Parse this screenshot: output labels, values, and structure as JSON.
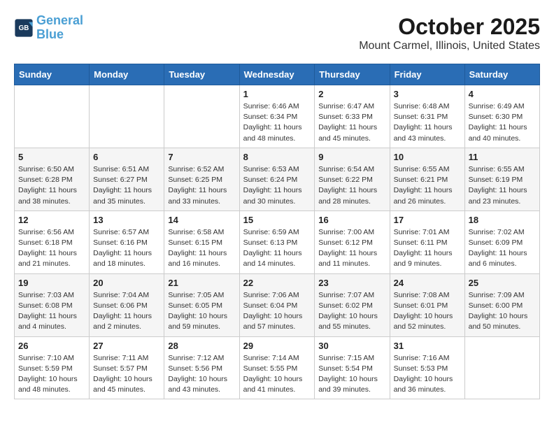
{
  "header": {
    "logo_line1": "General",
    "logo_line2": "Blue",
    "title": "October 2025",
    "subtitle": "Mount Carmel, Illinois, United States"
  },
  "weekdays": [
    "Sunday",
    "Monday",
    "Tuesday",
    "Wednesday",
    "Thursday",
    "Friday",
    "Saturday"
  ],
  "weeks": [
    [
      {
        "day": "",
        "info": ""
      },
      {
        "day": "",
        "info": ""
      },
      {
        "day": "",
        "info": ""
      },
      {
        "day": "1",
        "info": "Sunrise: 6:46 AM\nSunset: 6:34 PM\nDaylight: 11 hours and 48 minutes."
      },
      {
        "day": "2",
        "info": "Sunrise: 6:47 AM\nSunset: 6:33 PM\nDaylight: 11 hours and 45 minutes."
      },
      {
        "day": "3",
        "info": "Sunrise: 6:48 AM\nSunset: 6:31 PM\nDaylight: 11 hours and 43 minutes."
      },
      {
        "day": "4",
        "info": "Sunrise: 6:49 AM\nSunset: 6:30 PM\nDaylight: 11 hours and 40 minutes."
      }
    ],
    [
      {
        "day": "5",
        "info": "Sunrise: 6:50 AM\nSunset: 6:28 PM\nDaylight: 11 hours and 38 minutes."
      },
      {
        "day": "6",
        "info": "Sunrise: 6:51 AM\nSunset: 6:27 PM\nDaylight: 11 hours and 35 minutes."
      },
      {
        "day": "7",
        "info": "Sunrise: 6:52 AM\nSunset: 6:25 PM\nDaylight: 11 hours and 33 minutes."
      },
      {
        "day": "8",
        "info": "Sunrise: 6:53 AM\nSunset: 6:24 PM\nDaylight: 11 hours and 30 minutes."
      },
      {
        "day": "9",
        "info": "Sunrise: 6:54 AM\nSunset: 6:22 PM\nDaylight: 11 hours and 28 minutes."
      },
      {
        "day": "10",
        "info": "Sunrise: 6:55 AM\nSunset: 6:21 PM\nDaylight: 11 hours and 26 minutes."
      },
      {
        "day": "11",
        "info": "Sunrise: 6:55 AM\nSunset: 6:19 PM\nDaylight: 11 hours and 23 minutes."
      }
    ],
    [
      {
        "day": "12",
        "info": "Sunrise: 6:56 AM\nSunset: 6:18 PM\nDaylight: 11 hours and 21 minutes."
      },
      {
        "day": "13",
        "info": "Sunrise: 6:57 AM\nSunset: 6:16 PM\nDaylight: 11 hours and 18 minutes."
      },
      {
        "day": "14",
        "info": "Sunrise: 6:58 AM\nSunset: 6:15 PM\nDaylight: 11 hours and 16 minutes."
      },
      {
        "day": "15",
        "info": "Sunrise: 6:59 AM\nSunset: 6:13 PM\nDaylight: 11 hours and 14 minutes."
      },
      {
        "day": "16",
        "info": "Sunrise: 7:00 AM\nSunset: 6:12 PM\nDaylight: 11 hours and 11 minutes."
      },
      {
        "day": "17",
        "info": "Sunrise: 7:01 AM\nSunset: 6:11 PM\nDaylight: 11 hours and 9 minutes."
      },
      {
        "day": "18",
        "info": "Sunrise: 7:02 AM\nSunset: 6:09 PM\nDaylight: 11 hours and 6 minutes."
      }
    ],
    [
      {
        "day": "19",
        "info": "Sunrise: 7:03 AM\nSunset: 6:08 PM\nDaylight: 11 hours and 4 minutes."
      },
      {
        "day": "20",
        "info": "Sunrise: 7:04 AM\nSunset: 6:06 PM\nDaylight: 11 hours and 2 minutes."
      },
      {
        "day": "21",
        "info": "Sunrise: 7:05 AM\nSunset: 6:05 PM\nDaylight: 10 hours and 59 minutes."
      },
      {
        "day": "22",
        "info": "Sunrise: 7:06 AM\nSunset: 6:04 PM\nDaylight: 10 hours and 57 minutes."
      },
      {
        "day": "23",
        "info": "Sunrise: 7:07 AM\nSunset: 6:02 PM\nDaylight: 10 hours and 55 minutes."
      },
      {
        "day": "24",
        "info": "Sunrise: 7:08 AM\nSunset: 6:01 PM\nDaylight: 10 hours and 52 minutes."
      },
      {
        "day": "25",
        "info": "Sunrise: 7:09 AM\nSunset: 6:00 PM\nDaylight: 10 hours and 50 minutes."
      }
    ],
    [
      {
        "day": "26",
        "info": "Sunrise: 7:10 AM\nSunset: 5:59 PM\nDaylight: 10 hours and 48 minutes."
      },
      {
        "day": "27",
        "info": "Sunrise: 7:11 AM\nSunset: 5:57 PM\nDaylight: 10 hours and 45 minutes."
      },
      {
        "day": "28",
        "info": "Sunrise: 7:12 AM\nSunset: 5:56 PM\nDaylight: 10 hours and 43 minutes."
      },
      {
        "day": "29",
        "info": "Sunrise: 7:14 AM\nSunset: 5:55 PM\nDaylight: 10 hours and 41 minutes."
      },
      {
        "day": "30",
        "info": "Sunrise: 7:15 AM\nSunset: 5:54 PM\nDaylight: 10 hours and 39 minutes."
      },
      {
        "day": "31",
        "info": "Sunrise: 7:16 AM\nSunset: 5:53 PM\nDaylight: 10 hours and 36 minutes."
      },
      {
        "day": "",
        "info": ""
      }
    ]
  ]
}
